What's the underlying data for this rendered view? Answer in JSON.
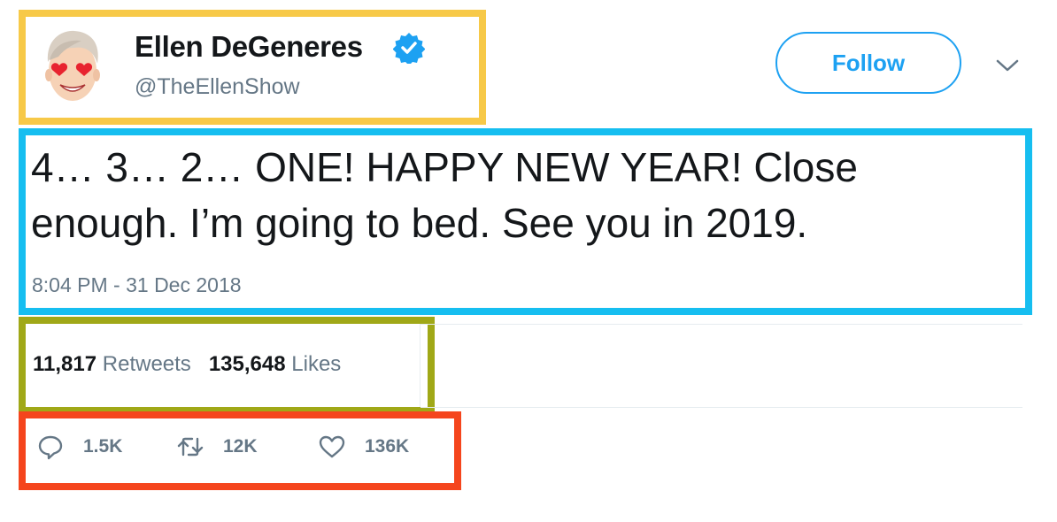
{
  "user": {
    "display_name": "Ellen DeGeneres",
    "handle": "@TheEllenShow",
    "verified": true
  },
  "follow_button": {
    "label": "Follow"
  },
  "tweet": {
    "text": "4… 3… 2… ONE! HAPPY NEW YEAR! Close enough. I’m going to bed. See you in 2019.",
    "timestamp": "8:04 PM - 31 Dec 2018"
  },
  "stats": {
    "retweets_count": "11,817",
    "retweets_label": "Retweets",
    "likes_count": "135,648",
    "likes_label": "Likes"
  },
  "actions": {
    "reply_count": "1.5K",
    "retweet_count": "12K",
    "like_count": "136K"
  },
  "icons": {
    "verified": "verified-badge-icon",
    "more": "chevron-down-icon",
    "reply": "reply-icon",
    "retweet": "retweet-icon",
    "like": "heart-icon"
  },
  "colors": {
    "brand_blue": "#1da1f2",
    "text_primary": "#14171a",
    "text_secondary": "#657786",
    "highlight_yellow": "#f7c948",
    "highlight_blue": "#16bef0",
    "highlight_olive": "#a0a817",
    "highlight_red": "#f5451d"
  }
}
